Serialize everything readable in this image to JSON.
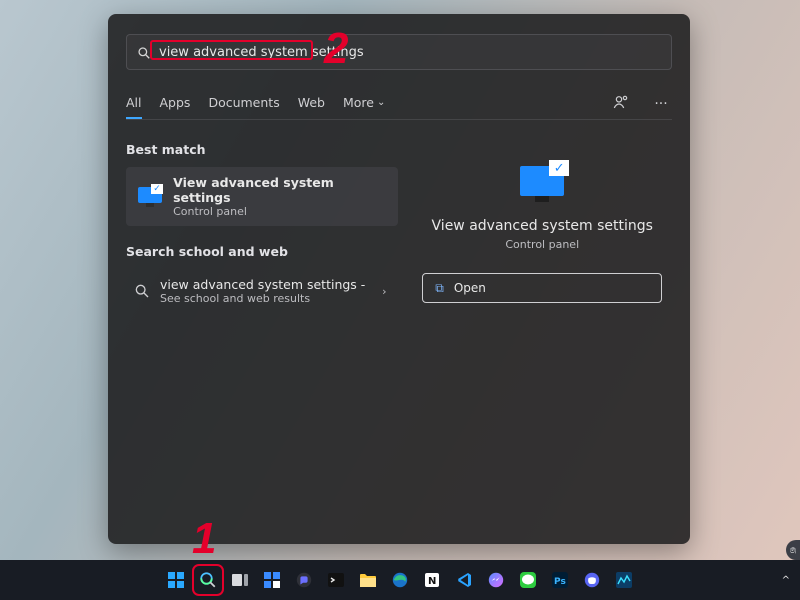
{
  "search": {
    "value": "view advanced system settings"
  },
  "tabs": {
    "all": "All",
    "apps": "Apps",
    "documents": "Documents",
    "web": "Web",
    "more": "More"
  },
  "sections": {
    "best_match": "Best match",
    "school_web": "Search school and web"
  },
  "best_result": {
    "title": "View advanced system settings",
    "subtitle": "Control panel"
  },
  "web_result": {
    "title": "view advanced system settings -",
    "subtitle": "See school and web results"
  },
  "preview": {
    "title": "View advanced system settings",
    "subtitle": "Control panel",
    "open_label": "Open"
  },
  "annotations": {
    "step1": "1",
    "step2": "2"
  },
  "tray": {
    "chevron": "^"
  }
}
